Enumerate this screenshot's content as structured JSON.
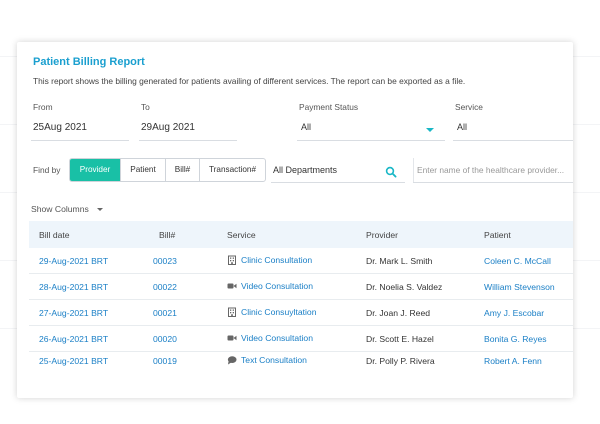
{
  "report": {
    "title": "Patient Billing Report",
    "description": "This report shows the billing generated for patients availing of different services. The report can be exported as a file."
  },
  "filters": {
    "from_label": "From",
    "from_value": "25Aug 2021",
    "to_label": "To",
    "to_value": "29Aug 2021",
    "payment_label": "Payment Status",
    "payment_value": "All",
    "service_label": "Service",
    "service_value": "All"
  },
  "findby": {
    "label": "Find by",
    "options": [
      "Provider",
      "Patient",
      "Bill#",
      "Transaction#"
    ],
    "active": "Provider",
    "department": "All Departments",
    "provider_placeholder": "Enter name of the healthcare provider..."
  },
  "show_columns": "Show Columns",
  "table": {
    "headers": [
      "Bill date",
      "Bill#",
      "Service",
      "Provider",
      "Patient"
    ],
    "rows": [
      {
        "date": "29-Aug-2021 BRT",
        "bill": "00023",
        "service": "Clinic Consultation",
        "service_icon": "clinic-icon",
        "provider": "Dr. Mark L. Smith",
        "patient": "Coleen C. McCall"
      },
      {
        "date": "28-Aug-2021 BRT",
        "bill": "00022",
        "service": "Video Consultation",
        "service_icon": "video-icon",
        "provider": "Dr. Noelia S. Valdez",
        "patient": "William  Stevenson"
      },
      {
        "date": "27-Aug-2021 BRT",
        "bill": "00021",
        "service": "Clinic Consuyltation",
        "service_icon": "clinic-icon",
        "provider": "Dr. Joan J. Reed",
        "patient": "Amy J. Escobar"
      },
      {
        "date": "26-Aug-2021 BRT",
        "bill": "00020",
        "service": "Video Consultation",
        "service_icon": "video-icon",
        "provider": "Dr. Scott E. Hazel",
        "patient": "Bonita G. Reyes"
      },
      {
        "date": "25-Aug-2021 BRT",
        "bill": "00019",
        "service": "Text Consultation",
        "service_icon": "chat-icon",
        "provider": "Dr. Polly P. Rivera",
        "patient": "Robert A. Fenn"
      }
    ]
  },
  "colors": {
    "accent": "#19c0a6",
    "link": "#1a7fc6",
    "title": "#1a9fcf"
  }
}
